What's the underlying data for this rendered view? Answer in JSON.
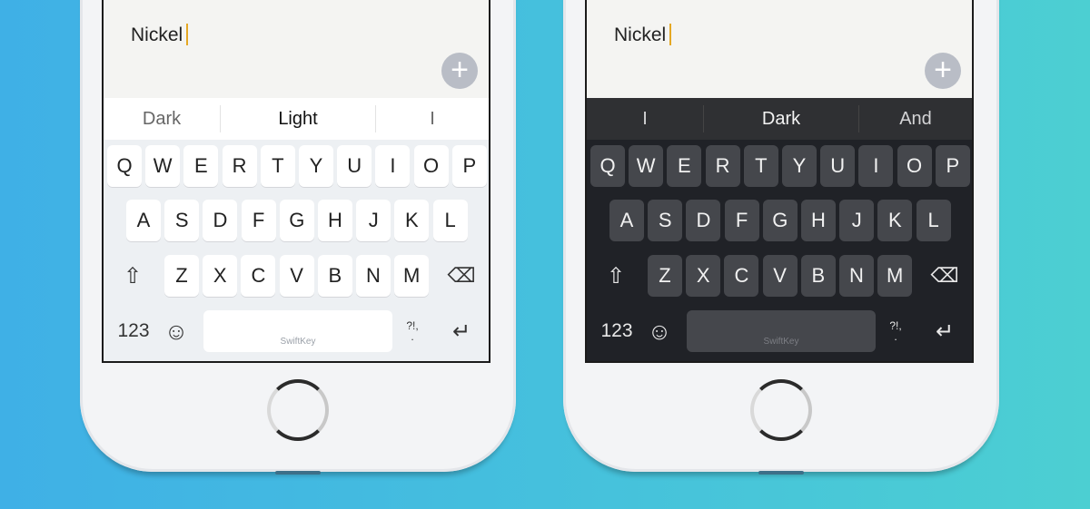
{
  "phones": [
    {
      "theme": "light",
      "note_text": "Nickel",
      "suggestions": [
        "Dark",
        "Light",
        "I"
      ],
      "row1": [
        "Q",
        "W",
        "E",
        "R",
        "T",
        "Y",
        "U",
        "I",
        "O",
        "P"
      ],
      "row2": [
        "A",
        "S",
        "D",
        "F",
        "G",
        "H",
        "J",
        "K",
        "L"
      ],
      "row3": [
        "Z",
        "X",
        "C",
        "V",
        "B",
        "N",
        "M"
      ],
      "numbers_label": "123",
      "space_brand": "SwiftKey",
      "punct_label": "?!,",
      "punct_dot": "."
    },
    {
      "theme": "dark",
      "note_text": "Nickel",
      "suggestions": [
        "I",
        "Dark",
        "And"
      ],
      "row1": [
        "Q",
        "W",
        "E",
        "R",
        "T",
        "Y",
        "U",
        "I",
        "O",
        "P"
      ],
      "row2": [
        "A",
        "S",
        "D",
        "F",
        "G",
        "H",
        "J",
        "K",
        "L"
      ],
      "row3": [
        "Z",
        "X",
        "C",
        "V",
        "B",
        "N",
        "M"
      ],
      "numbers_label": "123",
      "space_brand": "SwiftKey",
      "punct_label": "?!,",
      "punct_dot": "."
    }
  ],
  "icons": {
    "add": "+",
    "shift": "⇧",
    "backspace": "⌫",
    "emoji": "☺",
    "return": "↵"
  },
  "colors": {
    "cursor": "#e5a824",
    "background_start": "#3fb0e6",
    "background_end": "#4ccfd2"
  }
}
